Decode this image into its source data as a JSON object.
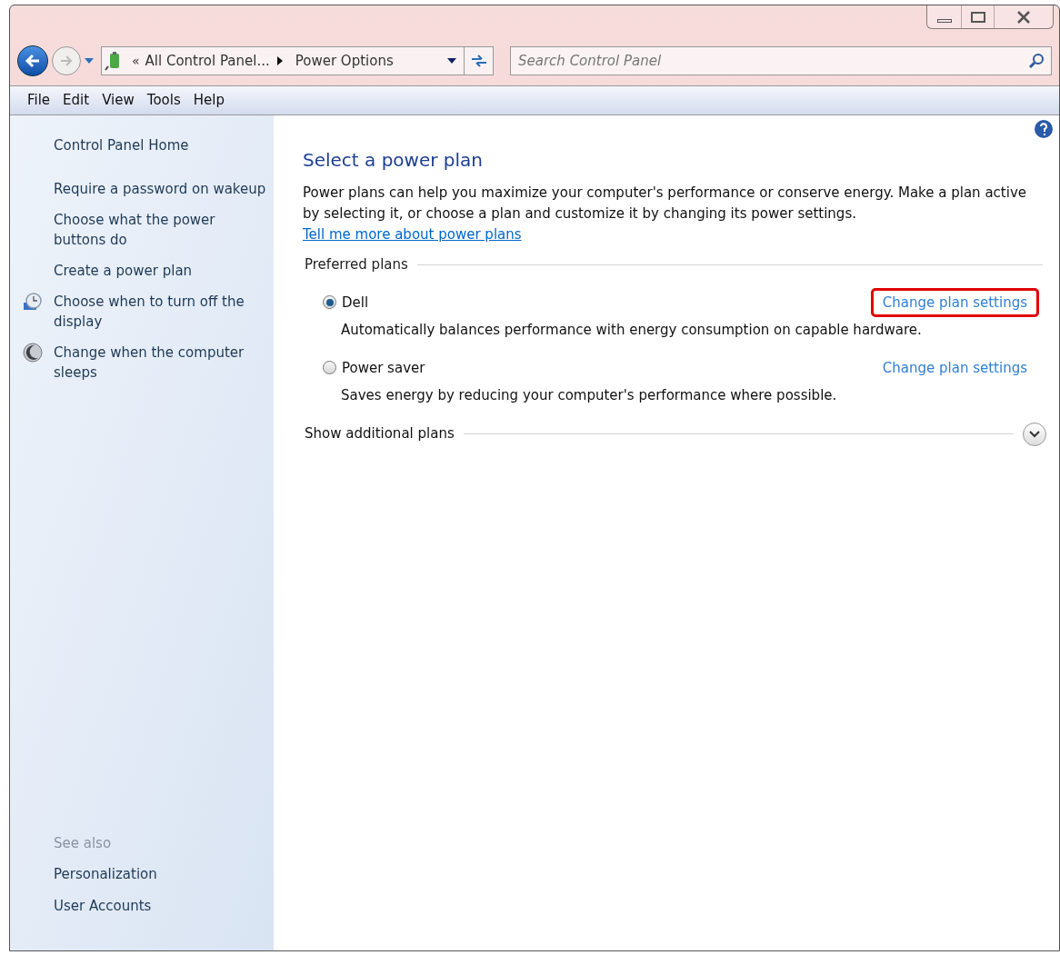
{
  "address_bar": {
    "overflow": "«",
    "breadcrumbs": [
      "All Control Panel...",
      "Power Options"
    ],
    "search_placeholder": "Search Control Panel"
  },
  "menu_bar": [
    "File",
    "Edit",
    "View",
    "Tools",
    "Help"
  ],
  "sidebar": {
    "items": [
      {
        "label": "Control Panel Home",
        "kind": "plain"
      },
      {
        "label": "Require a password on wakeup",
        "kind": "plain"
      },
      {
        "label": "Choose what the power buttons do",
        "kind": "plain"
      },
      {
        "label": "Create a power plan",
        "kind": "plain"
      },
      {
        "label": "Choose when to turn off the display",
        "kind": "display"
      },
      {
        "label": "Change when the computer sleeps",
        "kind": "sleep"
      }
    ],
    "see_also": {
      "heading": "See also",
      "items": [
        "Personalization",
        "User Accounts"
      ]
    }
  },
  "main": {
    "title": "Select a power plan",
    "intro": "Power plans can help you maximize your computer's performance or conserve energy. Make a plan active by selecting it, or choose a plan and customize it by changing its power settings.",
    "intro_link": "Tell me more about power plans",
    "group_label": "Preferred plans",
    "plans": [
      {
        "name": "Dell",
        "description": "Automatically balances performance with energy consumption on capable hardware.",
        "link": "Change plan settings",
        "selected": true,
        "highlighted": true
      },
      {
        "name": "Power saver",
        "description": "Saves energy by reducing your computer's performance where possible.",
        "link": "Change plan settings",
        "selected": false,
        "highlighted": false
      }
    ],
    "more_label": "Show additional plans",
    "more_expanded": false
  }
}
